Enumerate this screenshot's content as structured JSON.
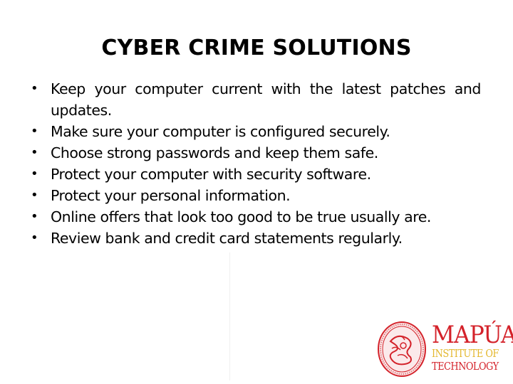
{
  "slide": {
    "title": "CYBER CRIME SOLUTIONS",
    "bullet_glyph": "•",
    "bullets": [
      {
        "text": "Keep your computer current with the latest patches and updates."
      },
      {
        "text": "Make sure your computer is configured securely."
      },
      {
        "text": "Choose strong passwords and keep them safe."
      },
      {
        "text": "Protect your computer with security software."
      },
      {
        "text": "Protect your personal information."
      },
      {
        "text": "Online offers that look too good to be true usually are."
      },
      {
        "text": "Review bank and credit card statements regularly."
      }
    ]
  },
  "logo": {
    "name": "MAPÚA",
    "line2": "INSTITUTE OF",
    "line3": "TECHNOLOGY",
    "seal_icon": "university-seal-icon",
    "colors": {
      "primary_red": "#d4222a",
      "gold": "#e3b72d"
    }
  }
}
